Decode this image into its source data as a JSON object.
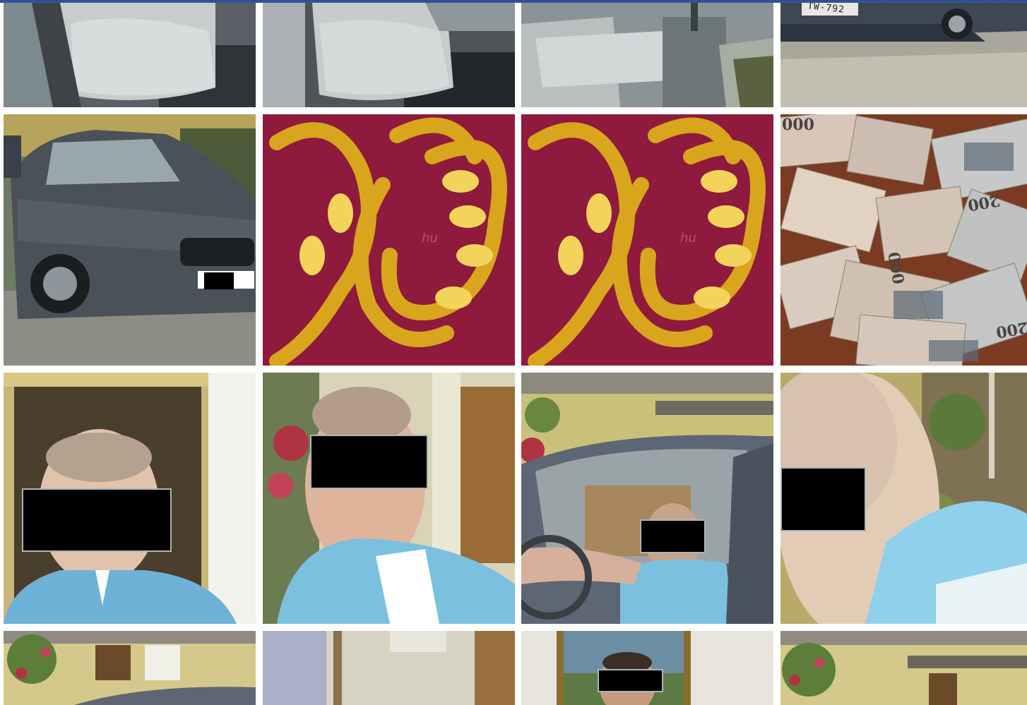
{
  "page": {
    "accent_color": "#3b5998",
    "background_color": "#ffffff"
  },
  "photos": [
    {
      "id": 1,
      "subject": "car-interior-seat",
      "icon": "photo-icon"
    },
    {
      "id": 2,
      "subject": "car-interior-seat",
      "icon": "photo-icon"
    },
    {
      "id": 3,
      "subject": "car-interior-console",
      "icon": "photo-icon"
    },
    {
      "id": 4,
      "subject": "car-rear-plate",
      "icon": "photo-icon",
      "plate_text": "TW-792"
    },
    {
      "id": 5,
      "subject": "grey-sedan",
      "icon": "photo-icon"
    },
    {
      "id": 6,
      "subject": "gold-chains",
      "icon": "photo-icon",
      "watermark": "hu"
    },
    {
      "id": 7,
      "subject": "gold-chains",
      "icon": "photo-icon",
      "watermark": "hu"
    },
    {
      "id": 8,
      "subject": "banknotes",
      "icon": "photo-icon",
      "notes": [
        "000",
        "200",
        "000",
        "200"
      ]
    },
    {
      "id": 9,
      "subject": "portrait-redacted",
      "icon": "photo-icon"
    },
    {
      "id": 10,
      "subject": "portrait-redacted",
      "icon": "photo-icon"
    },
    {
      "id": 11,
      "subject": "man-in-car-redacted",
      "icon": "photo-icon"
    },
    {
      "id": 12,
      "subject": "profile-redacted",
      "icon": "photo-icon"
    },
    {
      "id": 13,
      "subject": "house-yard",
      "icon": "photo-icon"
    },
    {
      "id": 14,
      "subject": "doorway",
      "icon": "photo-icon"
    },
    {
      "id": 15,
      "subject": "portrait-with-painting",
      "icon": "photo-icon"
    },
    {
      "id": 16,
      "subject": "house-yard",
      "icon": "photo-icon"
    }
  ]
}
